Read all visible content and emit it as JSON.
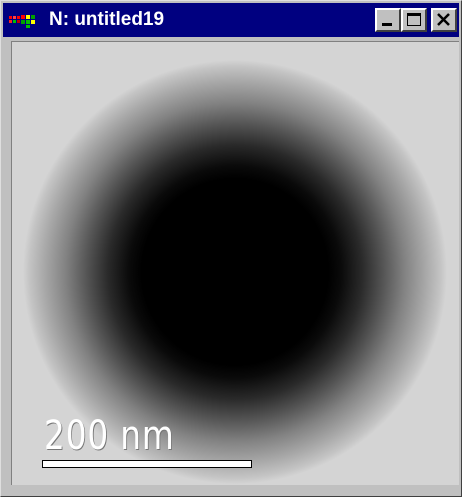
{
  "window": {
    "title": "N: untitled19",
    "controls": {
      "minimize": "minimize-icon",
      "maximize": "maximize-icon",
      "close": "close-icon"
    },
    "titlebar_color": "#000080"
  },
  "image": {
    "description_type": "grayscale radial gradient particle",
    "background_color": "#d4d4d4",
    "core_color": "#000000"
  },
  "scale_bar": {
    "label": "200 nm",
    "color": "#ffffff"
  }
}
